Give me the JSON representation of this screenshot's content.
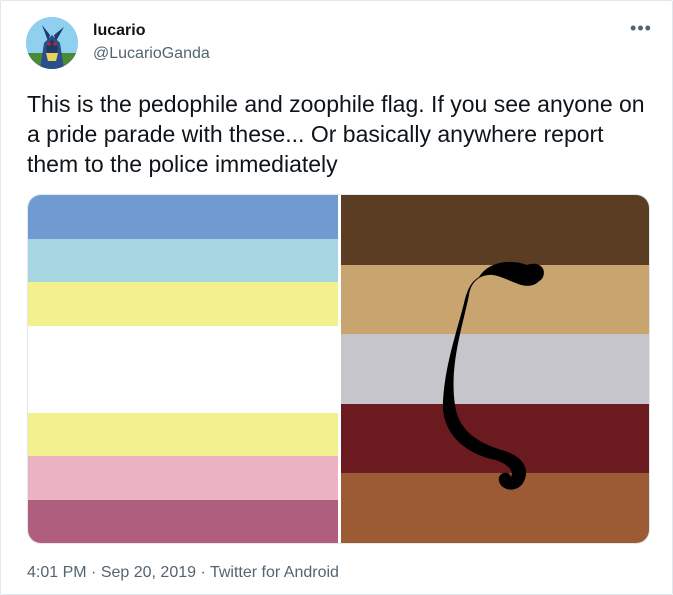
{
  "tweet": {
    "display_name": "lucario",
    "handle": "@LucarioGanda",
    "more_icon": "more-horizontal-icon",
    "text": "This is the pedophile and zoophile flag. If you see anyone on a pride parade with these... Or basically anywhere report them to the police immediately",
    "time": "4:01 PM",
    "separator": "·",
    "date": "Sep 20, 2019",
    "source": "Twitter for Android"
  },
  "media": {
    "left_flag_stripes": [
      "#6f9bd1",
      "#a8d5e2",
      "#f3f08e",
      "#ffffff",
      "#ffffff",
      "#f3f08e",
      "#ebb3c1",
      "#b05e7d"
    ],
    "right_flag_stripes": [
      "#5b3d24",
      "#c8a56e",
      "#c6c5cb",
      "#6b1b1f",
      "#9c5a35"
    ],
    "symbol_color": "#000000"
  },
  "colors": {
    "text": "#0f1419",
    "secondary": "#536471",
    "border": "#e1e8ed"
  }
}
